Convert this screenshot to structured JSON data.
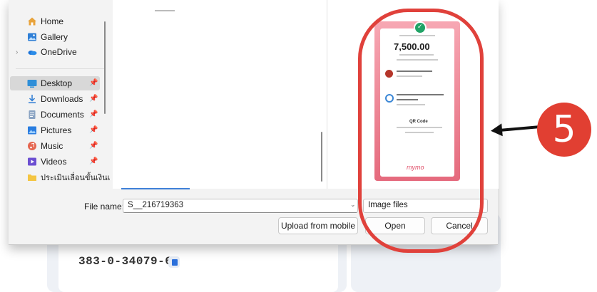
{
  "nav": {
    "items": [
      {
        "label": "Home",
        "icon": "home-icon"
      },
      {
        "label": "Gallery",
        "icon": "gallery-icon"
      },
      {
        "label": "OneDrive",
        "icon": "onedrive-icon"
      },
      {
        "label": "Desktop",
        "icon": "desktop-icon",
        "pinned": true,
        "selected": true
      },
      {
        "label": "Downloads",
        "icon": "download-icon",
        "pinned": true
      },
      {
        "label": "Documents",
        "icon": "documents-icon",
        "pinned": true
      },
      {
        "label": "Pictures",
        "icon": "pictures-icon",
        "pinned": true
      },
      {
        "label": "Music",
        "icon": "music-icon",
        "pinned": true
      },
      {
        "label": "Videos",
        "icon": "videos-icon",
        "pinned": true
      },
      {
        "label": "ประเมินเลื่อนขั้นเงินเ",
        "icon": "folder-icon"
      }
    ]
  },
  "bottom": {
    "file_name_label": "File name:",
    "file_name_value": "S__216719363",
    "file_type_value": "Image files",
    "upload_label": "Upload from mobile",
    "open_label": "Open",
    "cancel_label": "Cancel"
  },
  "preview": {
    "amount": "7,500.00",
    "qr_label": "QR Code",
    "logo_text": "mymo"
  },
  "background": {
    "account_number": "383-0-34079-6"
  },
  "annotation": {
    "step_number": "5",
    "color": "#e0413b"
  }
}
